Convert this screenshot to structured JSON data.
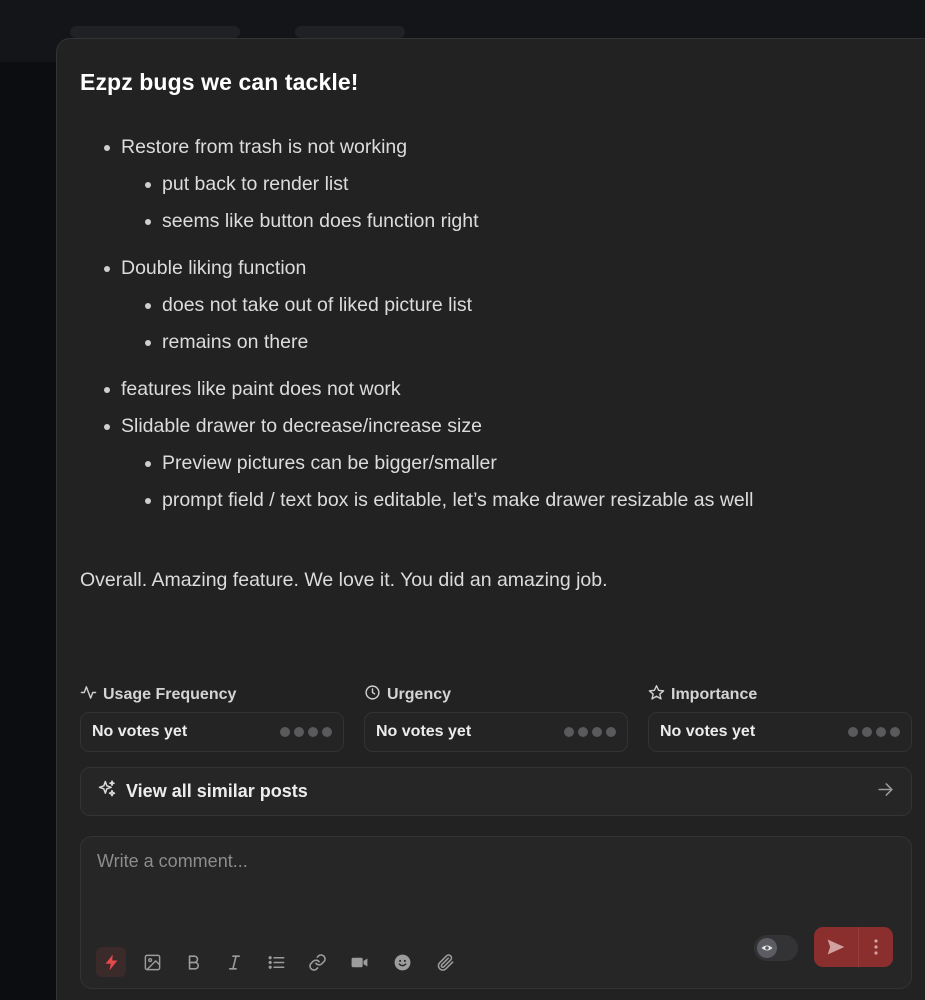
{
  "post": {
    "title": "Ezpz bugs we can tackle!",
    "body": [
      {
        "text": "Restore from trash is not working",
        "children": [
          "put back to render list",
          "seems like button does function right"
        ]
      },
      {
        "text": "Double liking function",
        "children": [
          "does not take out of liked picture list",
          "remains on there"
        ]
      },
      {
        "text": "features like paint does not work",
        "children": []
      },
      {
        "text": "Slidable drawer to decrease/increase size",
        "children": [
          "Preview pictures can be bigger/smaller",
          "prompt field / text box is editable, let’s make drawer resizable as well"
        ]
      }
    ],
    "closing": "Overall. Amazing feature. We love it. You did an amazing job."
  },
  "metrics": [
    {
      "label": "Usage Frequency",
      "icon": "activity-icon",
      "value": "No votes yet",
      "dots": 4
    },
    {
      "label": "Urgency",
      "icon": "clock-icon",
      "value": "No votes yet",
      "dots": 4
    },
    {
      "label": "Importance",
      "icon": "star-icon",
      "value": "No votes yet",
      "dots": 4
    }
  ],
  "similar": {
    "label": "View all similar posts",
    "icon": "sparkles-icon"
  },
  "composer": {
    "placeholder": "Write a comment...",
    "tools": [
      "bolt-icon",
      "image-icon",
      "bold-icon",
      "italic-icon",
      "list-icon",
      "link-icon",
      "video-icon",
      "emoji-icon",
      "attachment-icon"
    ]
  },
  "colors": {
    "accent": "#8a2e2e",
    "bolt": "#e5484d",
    "background": "#222222"
  }
}
